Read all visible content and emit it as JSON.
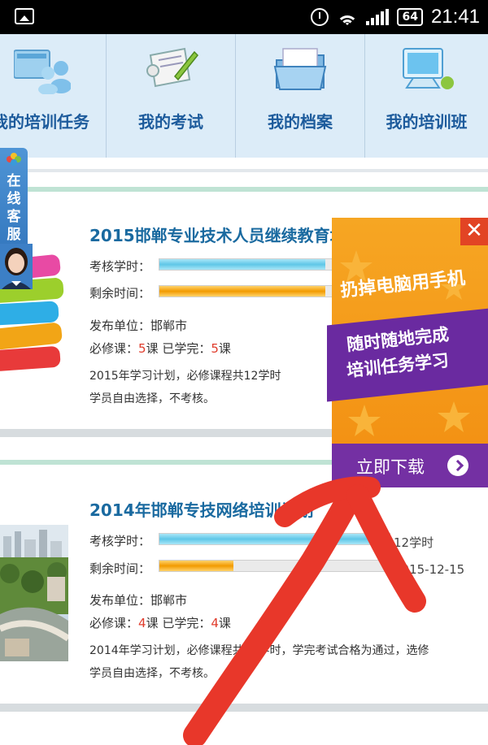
{
  "status_bar": {
    "battery": "64",
    "time": "21:41"
  },
  "nav": {
    "items": [
      {
        "label": "我的培训任务",
        "icon": "training-task-icon"
      },
      {
        "label": "我的考试",
        "icon": "exam-scroll-icon"
      },
      {
        "label": "我的档案",
        "icon": "archive-folder-icon"
      },
      {
        "label": "我的培训班",
        "icon": "training-class-icon"
      }
    ]
  },
  "service_tab": {
    "label": "在线客服"
  },
  "courses": [
    {
      "title": "2015邯郸专业技术人员继续教育培训计划",
      "hours_label": "考核学时：",
      "hours_progress": 0.72,
      "remaining_label": "剩余时间：",
      "remaining_progress": 0.72,
      "publisher_label": "发布单位：",
      "publisher": "邯郸市",
      "required_label": "必修课：",
      "required_count": "5",
      "required_unit": "课",
      "completed_label": "已学完：",
      "completed_count": "5",
      "completed_unit": "课",
      "desc_line1": "2015年学习计划，必修课程共12学时",
      "desc_line2": "学员自由选择，不考核。"
    },
    {
      "title": "2014年邯郸专技网络培训计划",
      "hours_label": "考核学时：",
      "hours_progress": 1.0,
      "hours_value": "12学时",
      "remaining_label": "剩余时间：",
      "remaining_progress": 0.32,
      "remaining_value": "2015-12-15",
      "publisher_label": "发布单位：",
      "publisher": "邯郸市",
      "required_label": "必修课：",
      "required_count": "4",
      "required_unit": "课",
      "completed_label": "已学完：",
      "completed_count": "4",
      "completed_unit": "课",
      "desc_line1": "2014年学习计划，必修课程共12学时，学完考试合格为通过，选修",
      "desc_line2": "学员自由选择，不考核。"
    }
  ],
  "promo": {
    "close": "✕",
    "line1": "扔掉电脑用手机",
    "line2": "随时随地完成",
    "line3": "培训任务学习",
    "download_label": "立即下载"
  },
  "colors": {
    "nav_bg": "#dcecf8",
    "title_blue": "#1a6aa0",
    "promo_orange": "#f39214",
    "promo_purple": "#7430a3",
    "annotation_red": "#e8372a"
  }
}
